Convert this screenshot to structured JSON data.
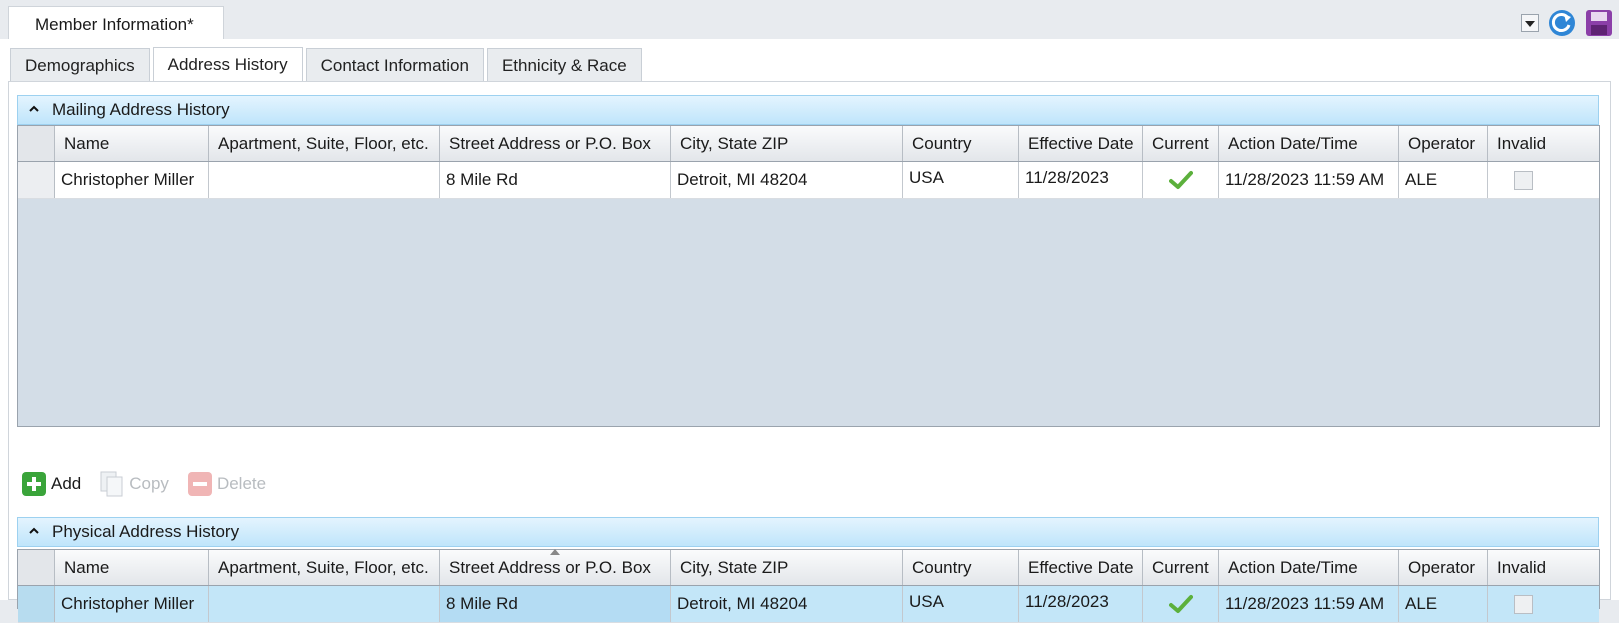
{
  "window": {
    "doc_tab_title": "Member Information*"
  },
  "top_icons": [
    "dropdown-icon",
    "refresh-icon",
    "save-icon"
  ],
  "tabs": [
    {
      "label": "Demographics"
    },
    {
      "label": "Address History",
      "active": true
    },
    {
      "label": "Contact Information"
    },
    {
      "label": "Ethnicity & Race"
    }
  ],
  "columns": [
    "Name",
    "Apartment, Suite, Floor, etc.",
    "Street Address or P.O. Box",
    "City, State ZIP",
    "Country",
    "Effective Date",
    "Current",
    "Action Date/Time",
    "Operator",
    "Invalid"
  ],
  "mailing": {
    "title": "Mailing Address History",
    "rows": [
      {
        "name": "Christopher Miller",
        "apartment": "",
        "street": "8 Mile Rd",
        "city": "Detroit, MI 48204",
        "country": "USA",
        "effective": "11/28/2023",
        "current": true,
        "action": "11/28/2023 11:59 AM",
        "operator": "ALE",
        "invalid": false
      }
    ]
  },
  "toolbar": {
    "add": "Add",
    "copy": "Copy",
    "delete": "Delete"
  },
  "physical": {
    "title": "Physical Address History",
    "rows": [
      {
        "name": "Christopher Miller",
        "apartment": "",
        "street": "8 Mile Rd",
        "city": "Detroit, MI 48204",
        "country": "USA",
        "effective": "11/28/2023",
        "current": true,
        "action": "11/28/2023 11:59 AM",
        "operator": "ALE",
        "invalid": false
      }
    ]
  }
}
